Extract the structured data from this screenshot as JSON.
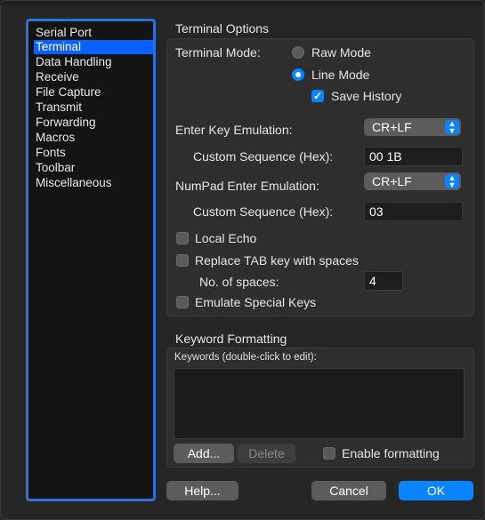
{
  "sidebar": {
    "items": [
      {
        "label": "Serial Port",
        "selected": false
      },
      {
        "label": "Terminal",
        "selected": true
      },
      {
        "label": "Data Handling",
        "selected": false
      },
      {
        "label": "Receive",
        "selected": false
      },
      {
        "label": "File Capture",
        "selected": false
      },
      {
        "label": "Transmit",
        "selected": false
      },
      {
        "label": "Forwarding",
        "selected": false
      },
      {
        "label": "Macros",
        "selected": false
      },
      {
        "label": "Fonts",
        "selected": false
      },
      {
        "label": "Toolbar",
        "selected": false
      },
      {
        "label": "Miscellaneous",
        "selected": false
      }
    ]
  },
  "terminal_options": {
    "title": "Terminal Options",
    "terminal_mode_label": "Terminal Mode:",
    "raw_mode_label": "Raw Mode",
    "line_mode_label": "Line Mode",
    "mode_selected": "Line Mode",
    "save_history_label": "Save History",
    "save_history_checked": true,
    "enter_key_label": "Enter Key Emulation:",
    "enter_key_value": "CR+LF",
    "enter_custom_label": "Custom Sequence (Hex):",
    "enter_custom_value": "00 1B",
    "numpad_label": "NumPad Enter Emulation:",
    "numpad_value": "CR+LF",
    "numpad_custom_label": "Custom Sequence (Hex):",
    "numpad_custom_value": "03",
    "local_echo_label": "Local Echo",
    "local_echo_checked": false,
    "replace_tab_label": "Replace TAB key with spaces",
    "replace_tab_checked": false,
    "spaces_label": "No. of spaces:",
    "spaces_value": "4",
    "emulate_keys_label": "Emulate Special Keys",
    "emulate_keys_checked": false
  },
  "keyword_formatting": {
    "title": "Keyword Formatting",
    "list_label": "Keywords (double-click to edit):",
    "add_label": "Add...",
    "delete_label": "Delete",
    "enable_label": "Enable formatting",
    "enable_checked": false
  },
  "footer": {
    "help_label": "Help...",
    "cancel_label": "Cancel",
    "ok_label": "OK"
  },
  "colors": {
    "accent": "#0a84ff",
    "selection": "#0a60ff",
    "sidebar_border": "#2f6fd6"
  }
}
